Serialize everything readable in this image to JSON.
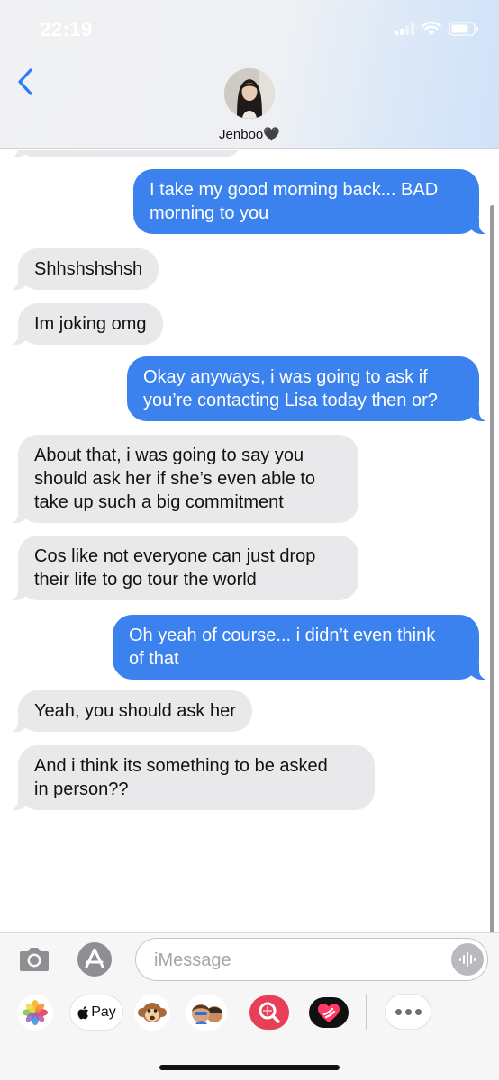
{
  "status_bar": {
    "time": "22:19"
  },
  "header": {
    "contact_name": "Jenboo🖤"
  },
  "messages": [
    {
      "direction": "out",
      "text": "I take my good morning back... BAD\nmorning to you"
    },
    {
      "direction": "in",
      "text": "Shhshshshsh"
    },
    {
      "direction": "in",
      "text": "Im joking omg"
    },
    {
      "direction": "out",
      "text": "Okay anyways, i was going to ask if\nyou’re contacting Lisa today then or?"
    },
    {
      "direction": "in",
      "text": "About that, i was going to say you\nshould ask her if she’s even able to\ntake up such a big commitment"
    },
    {
      "direction": "in",
      "text": "Cos like not everyone can just drop\ntheir life to go tour the world"
    },
    {
      "direction": "out",
      "text": "Oh yeah of course... i didn’t even think\nof that"
    },
    {
      "direction": "in",
      "text": "Yeah, you should ask her"
    },
    {
      "direction": "in",
      "text": "And i think its something to be asked\nin person??"
    }
  ],
  "input": {
    "placeholder": "iMessage",
    "value": ""
  },
  "app_drawer": {
    "apple_pay_label": "Pay",
    "apps": [
      "photos-icon",
      "apple-pay-icon",
      "monkey-memoji-icon",
      "memoji-stickers-icon",
      "image-search-icon",
      "digital-touch-icon",
      "more-apps-icon"
    ]
  },
  "colors": {
    "outgoing_bubble": "#3b82ee",
    "incoming_bubble": "#e9e9eb",
    "accent": "#2f7cf6"
  }
}
